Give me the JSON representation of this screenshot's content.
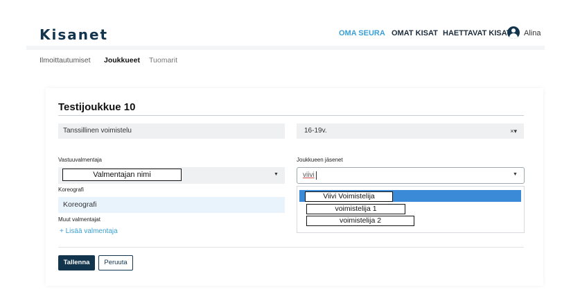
{
  "header": {
    "logo": "Kisanet",
    "nav": [
      "OMA SEURA",
      "OMAT KISAT",
      "HAETTAVAT KISAT"
    ],
    "user_name": "Alina",
    "active_color": "#3aa0d5",
    "brand_color": "#12344d"
  },
  "subnav": [
    "Ilmoittautumiset",
    "Joukkueet",
    "Tuomarit"
  ],
  "form": {
    "title": "Testijoukkue 10",
    "sport": "Tanssillinen voimistelu",
    "age_group": "16-19v.",
    "age_controls": "×▾",
    "coach_label": "Vastuuvalmentaja",
    "coach_value": "Valmentajan nimi",
    "choreographer_label": "Koreografi",
    "choreographer_value": "Koreografi",
    "other_coaches_label": "Muut valmentajat",
    "add_coach_link": "+ Lisää valmentaja",
    "members_label": "Joukkueen jäsenet",
    "members_query": "viivi",
    "member_options": [
      "Viivi Voimistelija",
      "voimistelija 1",
      "voimistelija 2"
    ],
    "save_button": "Tallenna",
    "cancel_button": "Peruuta"
  },
  "icons": {
    "avatar": "user-avatar-icon",
    "caret": "chevron-down-icon"
  }
}
